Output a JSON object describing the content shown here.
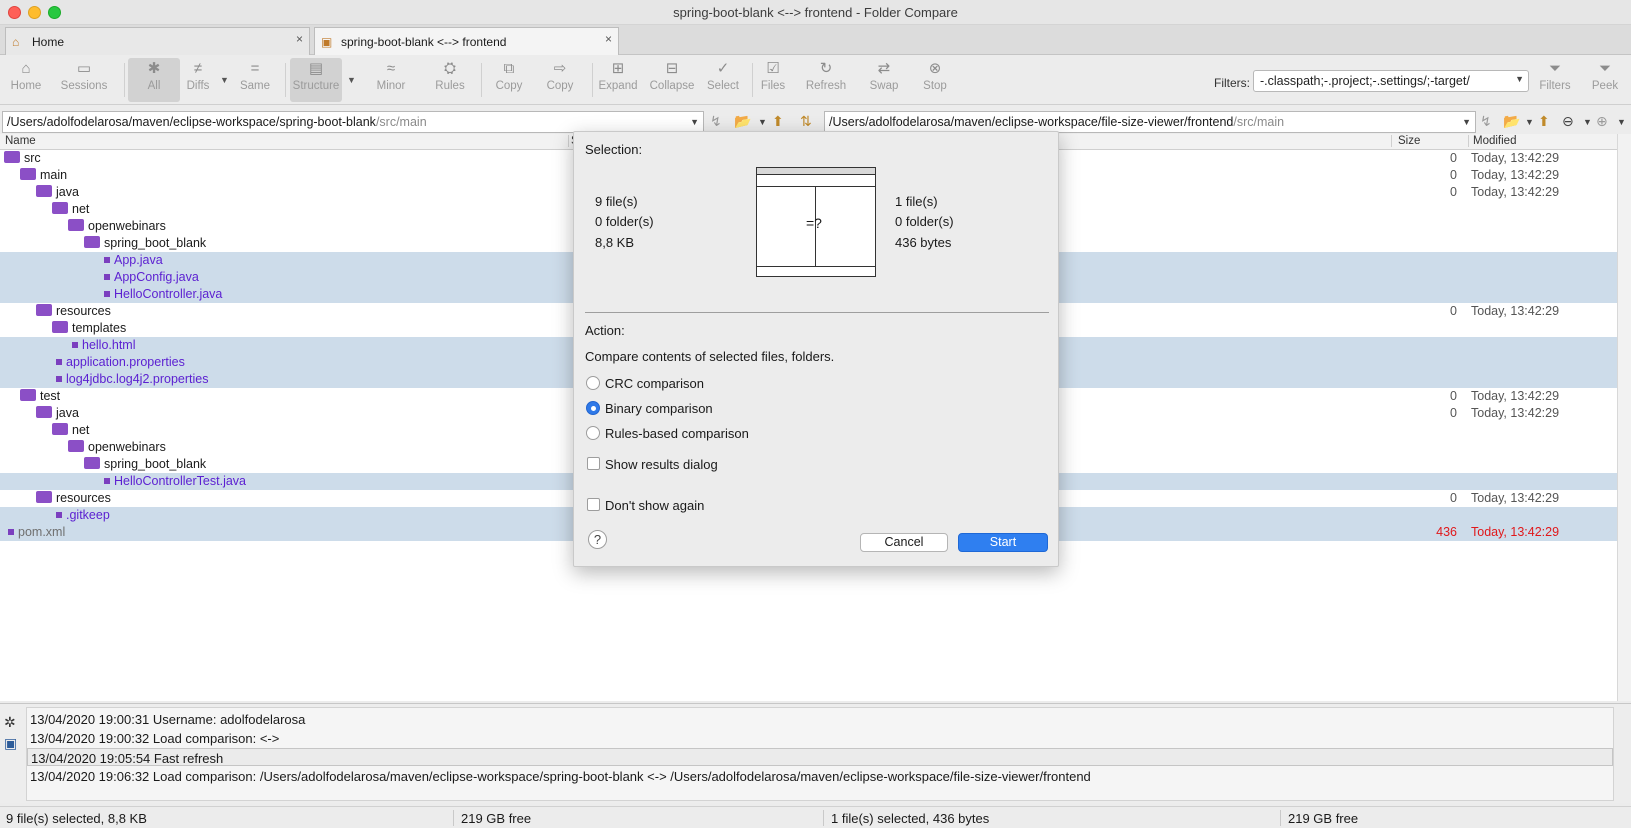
{
  "window": {
    "title": "spring-boot-blank <--> frontend - Folder Compare"
  },
  "tabs": [
    {
      "label": "Home",
      "icon": "home-icon"
    },
    {
      "label": "spring-boot-blank <--> frontend",
      "icon": "folder-compare-icon"
    }
  ],
  "toolbar": {
    "home": "Home",
    "sessions": "Sessions",
    "all": "All",
    "diffs": "Diffs",
    "same": "Same",
    "structure": "Structure",
    "minor": "Minor",
    "rules": "Rules",
    "copy1": "Copy",
    "copy2": "Copy",
    "expand": "Expand",
    "collapse": "Collapse",
    "select": "Select",
    "files": "Files",
    "refresh": "Refresh",
    "swap": "Swap",
    "stop": "Stop",
    "filters_btn": "Filters",
    "peek": "Peek",
    "filters_label": "Filters:",
    "filters_value": "-.classpath;-.project;-.settings/;-target/"
  },
  "paths": {
    "left_main": "/Users/adolfodelarosa/maven/eclipse-workspace/spring-boot-blank",
    "left_sub": "/src/main",
    "right_main": "/Users/adolfodelarosa/maven/eclipse-workspace/file-size-viewer/frontend",
    "right_sub": "/src/main"
  },
  "columns": {
    "name": "Name",
    "size_left": "S",
    "size": "Size",
    "modified": "Modified"
  },
  "tree": [
    {
      "name": "src",
      "type": "folder",
      "selected": false
    },
    {
      "name": "main",
      "type": "folder",
      "selected": false
    },
    {
      "name": "java",
      "type": "folder",
      "selected": false
    },
    {
      "name": "net",
      "type": "folder",
      "selected": false
    },
    {
      "name": "openwebinars",
      "type": "folder",
      "selected": false
    },
    {
      "name": "spring_boot_blank",
      "type": "folder",
      "selected": false
    },
    {
      "name": "App.java",
      "type": "file",
      "selected": true
    },
    {
      "name": "AppConfig.java",
      "type": "file",
      "selected": true
    },
    {
      "name": "HelloController.java",
      "type": "file",
      "selected": true
    },
    {
      "name": "resources",
      "type": "folder",
      "selected": false
    },
    {
      "name": "templates",
      "type": "folder",
      "selected": false
    },
    {
      "name": "hello.html",
      "type": "file",
      "selected": true
    },
    {
      "name": "application.properties",
      "type": "file",
      "selected": true
    },
    {
      "name": "log4jdbc.log4j2.properties",
      "type": "file",
      "selected": true
    },
    {
      "name": "test",
      "type": "folder",
      "selected": false
    },
    {
      "name": "java",
      "type": "folder",
      "selected": false
    },
    {
      "name": "net",
      "type": "folder",
      "selected": false
    },
    {
      "name": "openwebinars",
      "type": "folder",
      "selected": false
    },
    {
      "name": "spring_boot_blank",
      "type": "folder",
      "selected": false
    },
    {
      "name": "HelloControllerTest.java",
      "type": "file",
      "selected": true
    },
    {
      "name": "resources",
      "type": "folder",
      "selected": false
    },
    {
      "name": ".gitkeep",
      "type": "file",
      "selected": true
    },
    {
      "name": "pom.xml",
      "type": "file",
      "selected": true
    }
  ],
  "right_rows": [
    {
      "size": "0",
      "modified": "Today, 13:42:29"
    },
    {
      "size": "0",
      "modified": "Today, 13:42:29"
    },
    {
      "size": "0",
      "modified": "Today, 13:42:29"
    },
    {
      "size": "",
      "modified": ""
    },
    {
      "size": "",
      "modified": ""
    },
    {
      "size": "",
      "modified": ""
    },
    {
      "size": "",
      "modified": ""
    },
    {
      "size": "",
      "modified": ""
    },
    {
      "size": "",
      "modified": ""
    },
    {
      "size": "0",
      "modified": "Today, 13:42:29"
    },
    {
      "size": "",
      "modified": ""
    },
    {
      "size": "",
      "modified": ""
    },
    {
      "size": "",
      "modified": ""
    },
    {
      "size": "",
      "modified": ""
    },
    {
      "size": "0",
      "modified": "Today, 13:42:29"
    },
    {
      "size": "0",
      "modified": "Today, 13:42:29"
    },
    {
      "size": "",
      "modified": ""
    },
    {
      "size": "",
      "modified": ""
    },
    {
      "size": "",
      "modified": ""
    },
    {
      "size": "",
      "modified": ""
    },
    {
      "size": "0",
      "modified": "Today, 13:42:29"
    },
    {
      "size": "",
      "modified": ""
    },
    {
      "size": "436",
      "modified": "Today, 13:42:29"
    }
  ],
  "dialog": {
    "selection_label": "Selection:",
    "left_files": "9 file(s)",
    "left_folders": "0 folder(s)",
    "left_size": "8,8 KB",
    "right_files": "1 file(s)",
    "right_folders": "0 folder(s)",
    "right_size": "436 bytes",
    "diagram_symbol": "=?",
    "action_label": "Action:",
    "action_desc": "Compare contents of selected files, folders.",
    "opt_crc": "CRC comparison",
    "opt_binary": "Binary comparison",
    "opt_rules": "Rules-based comparison",
    "show_results": "Show results dialog",
    "dont_show": "Don't show again",
    "help": "?",
    "cancel": "Cancel",
    "start": "Start",
    "selected_option": "binary"
  },
  "log": [
    "13/04/2020 19:00:31  Username: adolfodelarosa",
    "13/04/2020 19:00:32  Load comparison:  <->",
    "13/04/2020 19:05:54  Fast refresh",
    "13/04/2020 19:06:32  Load comparison: /Users/adolfodelarosa/maven/eclipse-workspace/spring-boot-blank <-> /Users/adolfodelarosa/maven/eclipse-workspace/file-size-viewer/frontend"
  ],
  "status": {
    "left_selected": "9 file(s) selected, 8,8 KB",
    "left_free": "219 GB free",
    "right_selected": "1 file(s) selected, 436 bytes",
    "right_free": "219 GB free"
  }
}
